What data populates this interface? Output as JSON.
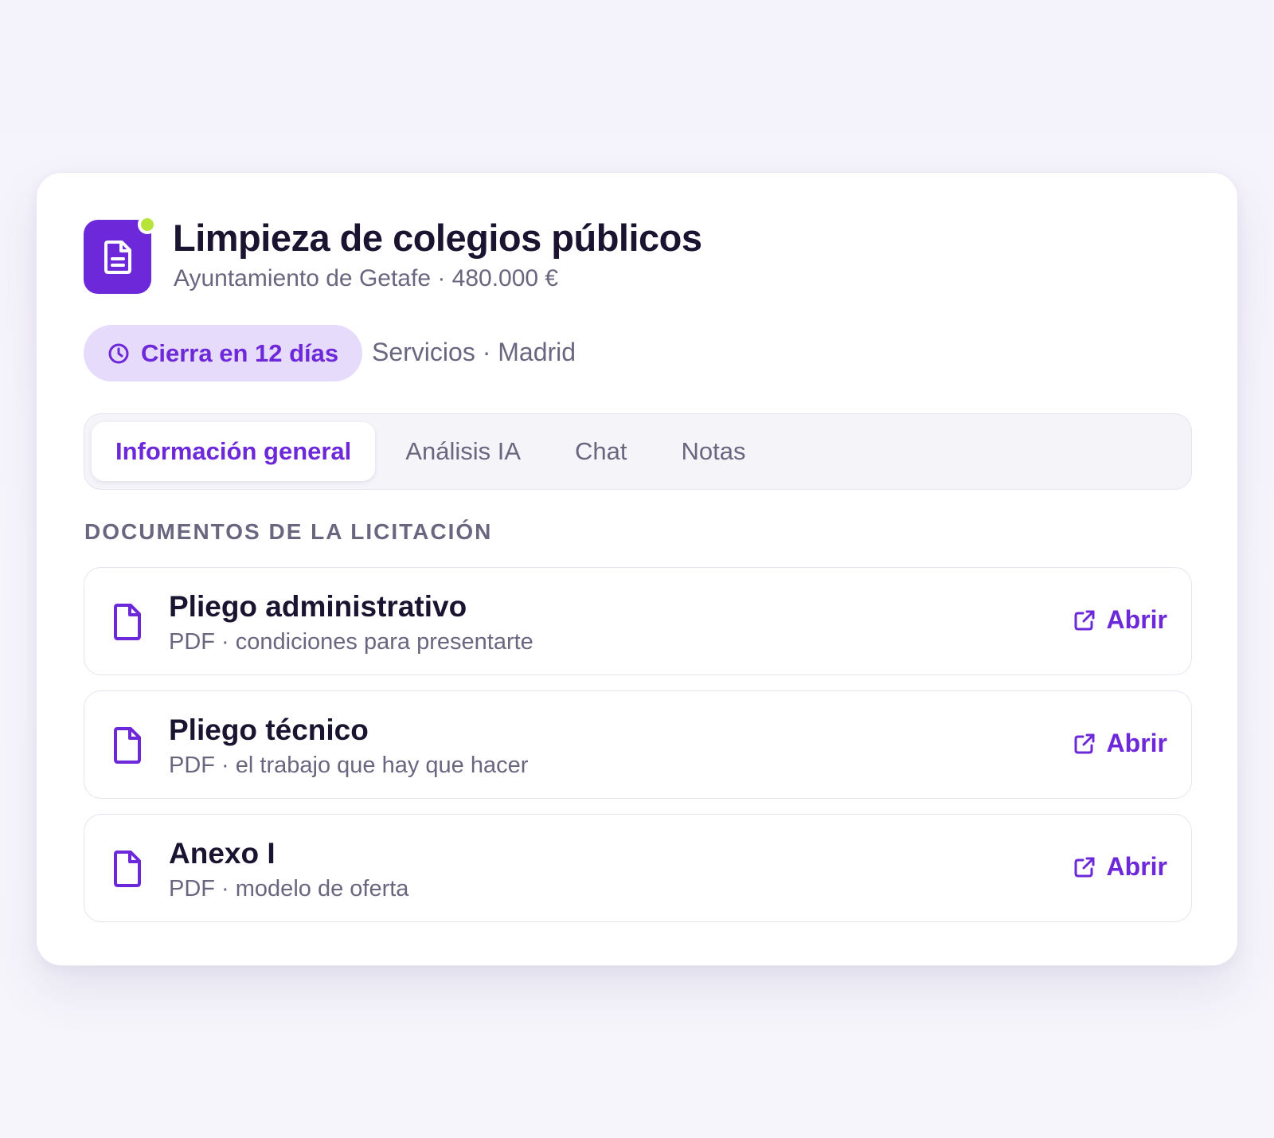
{
  "header": {
    "icon": "document-icon",
    "title": "Limpieza de colegios públicos",
    "subtitle": "Ayuntamiento de Getafe · 480.000 €",
    "status_dot_color": "#b7e33b"
  },
  "deadline": {
    "icon": "clock-icon",
    "label": "Cierra en 12 días"
  },
  "meta": "Servicios · Madrid",
  "tabs": [
    {
      "label": "Información general",
      "active": true
    },
    {
      "label": "Análisis IA",
      "active": false
    },
    {
      "label": "Chat",
      "active": false
    },
    {
      "label": "Notas",
      "active": false
    }
  ],
  "section_title": "DOCUMENTOS DE LA LICITACIÓN",
  "documents": [
    {
      "icon": "file-icon",
      "name": "Pliego administrativo",
      "description": "PDF · condiciones para presentarte",
      "action_icon": "external-link-icon",
      "action_label": "Abrir"
    },
    {
      "icon": "file-icon",
      "name": "Pliego técnico",
      "description": "PDF · el trabajo que hay que hacer",
      "action_icon": "external-link-icon",
      "action_label": "Abrir"
    },
    {
      "icon": "file-icon",
      "name": "Anexo I",
      "description": "PDF · modelo de oferta",
      "action_icon": "external-link-icon",
      "action_label": "Abrir"
    }
  ],
  "colors": {
    "accent": "#6d28d9",
    "accent_soft": "#e6dbfb",
    "text_primary": "#1b1431",
    "text_secondary": "#6b6680"
  }
}
